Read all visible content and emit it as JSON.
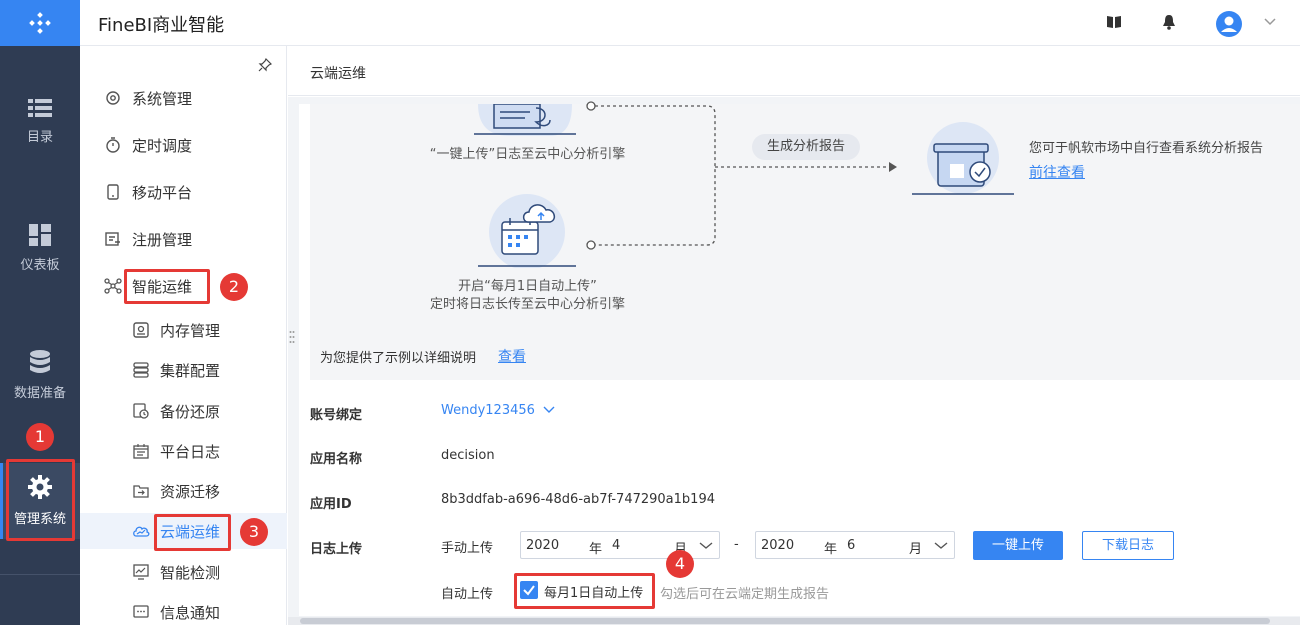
{
  "header": {
    "app_title": "FineBI商业智能"
  },
  "rail": {
    "items": [
      {
        "label": "目录"
      },
      {
        "label": "仪表板"
      },
      {
        "label": "数据准备"
      },
      {
        "label": "管理系统"
      }
    ]
  },
  "subnav": {
    "items": [
      {
        "label": "系统管理"
      },
      {
        "label": "定时调度"
      },
      {
        "label": "移动平台"
      },
      {
        "label": "注册管理"
      },
      {
        "label": "智能运维"
      },
      {
        "label": "内存管理"
      },
      {
        "label": "集群配置"
      },
      {
        "label": "备份还原"
      },
      {
        "label": "平台日志"
      },
      {
        "label": "资源迁移"
      },
      {
        "label": "云端运维"
      },
      {
        "label": "智能检测"
      },
      {
        "label": "信息通知"
      }
    ]
  },
  "breadcrumb": "云端运维",
  "flow": {
    "step1_text": "“一键上传”日志至云中心分析引擎",
    "step2_line1": "开启“每月1日自动上传”",
    "step2_line2": "定时将日志长传至云中心分析引擎",
    "pill": "生成分析报告",
    "report_text": "您可于帆软市场中自行查看系统分析报告",
    "report_link": "前往查看",
    "example_text": "为您提供了示例以详细说明",
    "example_link": "查看"
  },
  "form": {
    "account_label": "账号绑定",
    "account_value": "Wendy123456",
    "appname_label": "应用名称",
    "appname_value": "decision",
    "appid_label": "应用ID",
    "appid_value": "8b3ddfab-a696-48d6-ab7f-747290a1b194",
    "log_label": "日志上传",
    "manual_label": "手动上传",
    "from_year": "2020",
    "from_month": "4",
    "to_year": "2020",
    "to_month": "6",
    "year_unit": "年",
    "month_unit": "月",
    "range_sep": "-",
    "upload_button": "一键上传",
    "download_button": "下载日志",
    "auto_label": "自动上传",
    "auto_checkbox_label": "每月1日自动上传",
    "auto_hint": "勾选后可在云端定期生成报告"
  },
  "annotations": [
    "1",
    "2",
    "3",
    "4"
  ],
  "colors": {
    "rail_bg": "#2f3c53",
    "accent": "#3685f2",
    "highlight_red": "#e53935"
  }
}
